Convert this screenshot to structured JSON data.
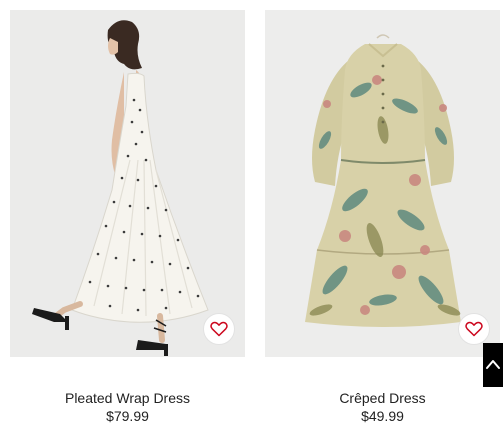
{
  "products": [
    {
      "name": "Pleated Wrap Dress",
      "price": "$79.99",
      "image_icon": "dress-photo",
      "favorite_icon": "heart-icon"
    },
    {
      "name": "Crêped Dress",
      "price": "$49.99",
      "image_icon": "dress-photo",
      "favorite_icon": "heart-icon"
    }
  ],
  "scroll_top_icon": "arrow-up-icon",
  "colors": {
    "favorite": "#cc071e",
    "scroll_button": "#000000",
    "text": "#222222"
  }
}
